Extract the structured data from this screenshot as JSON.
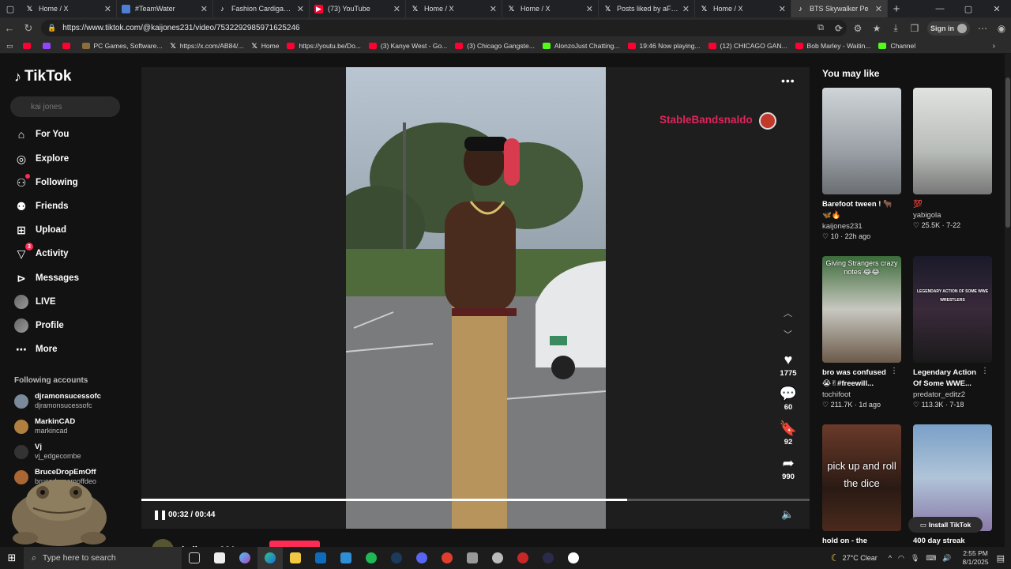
{
  "browser": {
    "tabs": [
      {
        "title": "Home / X",
        "icon": "x"
      },
      {
        "title": "#TeamWater",
        "icon": "globe"
      },
      {
        "title": "Fashion Cardigan and",
        "icon": "tt"
      },
      {
        "title": "(73) YouTube",
        "icon": "yt"
      },
      {
        "title": "Home / X",
        "icon": "x"
      },
      {
        "title": "Home / X",
        "icon": "x"
      },
      {
        "title": "Posts liked by aFlaxLife",
        "icon": "x"
      },
      {
        "title": "Home / X",
        "icon": "x"
      },
      {
        "title": "BTS Skywalker Pe",
        "icon": "tt"
      }
    ],
    "url": "https://www.tiktok.com/@kaijones231/video/7532292985971625246",
    "sign_in": "Sign in",
    "bookmarks": [
      {
        "label": "",
        "icon": "yt"
      },
      {
        "label": "",
        "icon": "tw"
      },
      {
        "label": "",
        "icon": "yt"
      },
      {
        "label": "PC Games, Software...",
        "icon": "pc"
      },
      {
        "label": "https://x.com/AB84/...",
        "icon": "x"
      },
      {
        "label": "Home",
        "icon": "x"
      },
      {
        "label": "https://youtu.be/Do...",
        "icon": "yt"
      },
      {
        "label": "(3) Kanye West - Go...",
        "icon": "yt"
      },
      {
        "label": "(3) Chicago Gangste...",
        "icon": "yt"
      },
      {
        "label": "AlonzoJust Chatting...",
        "icon": "k"
      },
      {
        "label": "19:46 Now playing...",
        "icon": "yt"
      },
      {
        "label": "(12) CHICAGO GAN...",
        "icon": "yt"
      },
      {
        "label": "Bob Marley - Waitin...",
        "icon": "yt"
      },
      {
        "label": "Channel",
        "icon": "k"
      }
    ]
  },
  "sidebar": {
    "logo": "TikTok",
    "search_placeholder": "kai jones",
    "nav": [
      {
        "label": "For You",
        "icon": "home-icon"
      },
      {
        "label": "Explore",
        "icon": "compass-icon"
      },
      {
        "label": "Following",
        "icon": "users-icon"
      },
      {
        "label": "Friends",
        "icon": "friends-icon"
      },
      {
        "label": "Upload",
        "icon": "plus-square-icon"
      },
      {
        "label": "Activity",
        "icon": "inbox-icon",
        "badge": "3"
      },
      {
        "label": "Messages",
        "icon": "send-icon"
      },
      {
        "label": "LIVE",
        "icon": "live-avatar-icon"
      },
      {
        "label": "Profile",
        "icon": "profile-avatar-icon"
      },
      {
        "label": "More",
        "icon": "more-icon"
      }
    ],
    "following_title": "Following accounts",
    "accounts": [
      {
        "name": "djramonsucessofc",
        "handle": "djramonsucessofc",
        "color": "#7a8a9a"
      },
      {
        "name": "MarkinCAD",
        "handle": "markincad",
        "color": "#b08040"
      },
      {
        "name": "Vj",
        "handle": "vj_edgecombe",
        "color": "#333333"
      },
      {
        "name": "BruceDropEmOff",
        "handle": "brucedropemoffdeo",
        "color": "#aa6633"
      }
    ]
  },
  "video": {
    "overlay_text": "StableBandsnaldo",
    "progress": 0.727,
    "time": "00:32 / 00:44",
    "likes": "1775",
    "comments": "60",
    "saves": "92",
    "shares": "990",
    "author": "kaijones231"
  },
  "recommended": {
    "title": "You may like",
    "items": [
      {
        "title": "Barefoot tween ! 🐂",
        "title2": "🦋🔥",
        "user": "kaijones231",
        "stats": "♡ 10 · 22h ago"
      },
      {
        "title": "💯",
        "user": "yabigola",
        "stats": "♡ 25.5K · 7-22"
      },
      {
        "title": "bro was confused",
        "title2": "😭✌#freewill...",
        "user": "tochifoot",
        "stats": "♡ 211.7K · 1d ago",
        "thumb_text": "Giving Strangers crazy notes 😂😂"
      },
      {
        "title": "Legendary Action",
        "title2": "Of Some WWE...",
        "user": "predator_editz2",
        "stats": "♡ 113.3K · 7-18",
        "thumb_text": "LEGENDARY ACTION OF SOME WWE WRESTLERS"
      },
      {
        "title": "hold on - the",
        "user": "",
        "stats": "",
        "thumb_text": "pick up and roll the dice"
      },
      {
        "title": "400 day streak",
        "user": "",
        "stats": ""
      }
    ],
    "install": "Install TikTok"
  },
  "taskbar": {
    "search_placeholder": "Type here to search",
    "weather": "27°C  Clear",
    "time": "2:55 PM",
    "date": "8/1/2025"
  }
}
